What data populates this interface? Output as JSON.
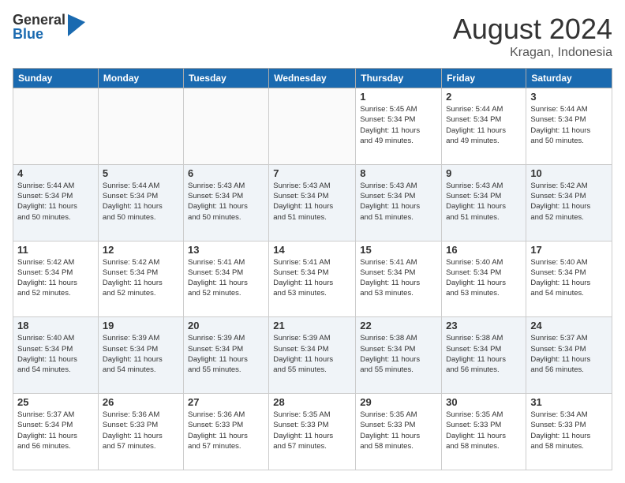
{
  "header": {
    "logo_general": "General",
    "logo_blue": "Blue",
    "month_year": "August 2024",
    "location": "Kragan, Indonesia"
  },
  "days_of_week": [
    "Sunday",
    "Monday",
    "Tuesday",
    "Wednesday",
    "Thursday",
    "Friday",
    "Saturday"
  ],
  "weeks": [
    [
      {
        "day": "",
        "info": ""
      },
      {
        "day": "",
        "info": ""
      },
      {
        "day": "",
        "info": ""
      },
      {
        "day": "",
        "info": ""
      },
      {
        "day": "1",
        "info": "Sunrise: 5:45 AM\nSunset: 5:34 PM\nDaylight: 11 hours\nand 49 minutes."
      },
      {
        "day": "2",
        "info": "Sunrise: 5:44 AM\nSunset: 5:34 PM\nDaylight: 11 hours\nand 49 minutes."
      },
      {
        "day": "3",
        "info": "Sunrise: 5:44 AM\nSunset: 5:34 PM\nDaylight: 11 hours\nand 50 minutes."
      }
    ],
    [
      {
        "day": "4",
        "info": "Sunrise: 5:44 AM\nSunset: 5:34 PM\nDaylight: 11 hours\nand 50 minutes."
      },
      {
        "day": "5",
        "info": "Sunrise: 5:44 AM\nSunset: 5:34 PM\nDaylight: 11 hours\nand 50 minutes."
      },
      {
        "day": "6",
        "info": "Sunrise: 5:43 AM\nSunset: 5:34 PM\nDaylight: 11 hours\nand 50 minutes."
      },
      {
        "day": "7",
        "info": "Sunrise: 5:43 AM\nSunset: 5:34 PM\nDaylight: 11 hours\nand 51 minutes."
      },
      {
        "day": "8",
        "info": "Sunrise: 5:43 AM\nSunset: 5:34 PM\nDaylight: 11 hours\nand 51 minutes."
      },
      {
        "day": "9",
        "info": "Sunrise: 5:43 AM\nSunset: 5:34 PM\nDaylight: 11 hours\nand 51 minutes."
      },
      {
        "day": "10",
        "info": "Sunrise: 5:42 AM\nSunset: 5:34 PM\nDaylight: 11 hours\nand 52 minutes."
      }
    ],
    [
      {
        "day": "11",
        "info": "Sunrise: 5:42 AM\nSunset: 5:34 PM\nDaylight: 11 hours\nand 52 minutes."
      },
      {
        "day": "12",
        "info": "Sunrise: 5:42 AM\nSunset: 5:34 PM\nDaylight: 11 hours\nand 52 minutes."
      },
      {
        "day": "13",
        "info": "Sunrise: 5:41 AM\nSunset: 5:34 PM\nDaylight: 11 hours\nand 52 minutes."
      },
      {
        "day": "14",
        "info": "Sunrise: 5:41 AM\nSunset: 5:34 PM\nDaylight: 11 hours\nand 53 minutes."
      },
      {
        "day": "15",
        "info": "Sunrise: 5:41 AM\nSunset: 5:34 PM\nDaylight: 11 hours\nand 53 minutes."
      },
      {
        "day": "16",
        "info": "Sunrise: 5:40 AM\nSunset: 5:34 PM\nDaylight: 11 hours\nand 53 minutes."
      },
      {
        "day": "17",
        "info": "Sunrise: 5:40 AM\nSunset: 5:34 PM\nDaylight: 11 hours\nand 54 minutes."
      }
    ],
    [
      {
        "day": "18",
        "info": "Sunrise: 5:40 AM\nSunset: 5:34 PM\nDaylight: 11 hours\nand 54 minutes."
      },
      {
        "day": "19",
        "info": "Sunrise: 5:39 AM\nSunset: 5:34 PM\nDaylight: 11 hours\nand 54 minutes."
      },
      {
        "day": "20",
        "info": "Sunrise: 5:39 AM\nSunset: 5:34 PM\nDaylight: 11 hours\nand 55 minutes."
      },
      {
        "day": "21",
        "info": "Sunrise: 5:39 AM\nSunset: 5:34 PM\nDaylight: 11 hours\nand 55 minutes."
      },
      {
        "day": "22",
        "info": "Sunrise: 5:38 AM\nSunset: 5:34 PM\nDaylight: 11 hours\nand 55 minutes."
      },
      {
        "day": "23",
        "info": "Sunrise: 5:38 AM\nSunset: 5:34 PM\nDaylight: 11 hours\nand 56 minutes."
      },
      {
        "day": "24",
        "info": "Sunrise: 5:37 AM\nSunset: 5:34 PM\nDaylight: 11 hours\nand 56 minutes."
      }
    ],
    [
      {
        "day": "25",
        "info": "Sunrise: 5:37 AM\nSunset: 5:34 PM\nDaylight: 11 hours\nand 56 minutes."
      },
      {
        "day": "26",
        "info": "Sunrise: 5:36 AM\nSunset: 5:33 PM\nDaylight: 11 hours\nand 57 minutes."
      },
      {
        "day": "27",
        "info": "Sunrise: 5:36 AM\nSunset: 5:33 PM\nDaylight: 11 hours\nand 57 minutes."
      },
      {
        "day": "28",
        "info": "Sunrise: 5:35 AM\nSunset: 5:33 PM\nDaylight: 11 hours\nand 57 minutes."
      },
      {
        "day": "29",
        "info": "Sunrise: 5:35 AM\nSunset: 5:33 PM\nDaylight: 11 hours\nand 58 minutes."
      },
      {
        "day": "30",
        "info": "Sunrise: 5:35 AM\nSunset: 5:33 PM\nDaylight: 11 hours\nand 58 minutes."
      },
      {
        "day": "31",
        "info": "Sunrise: 5:34 AM\nSunset: 5:33 PM\nDaylight: 11 hours\nand 58 minutes."
      }
    ]
  ]
}
